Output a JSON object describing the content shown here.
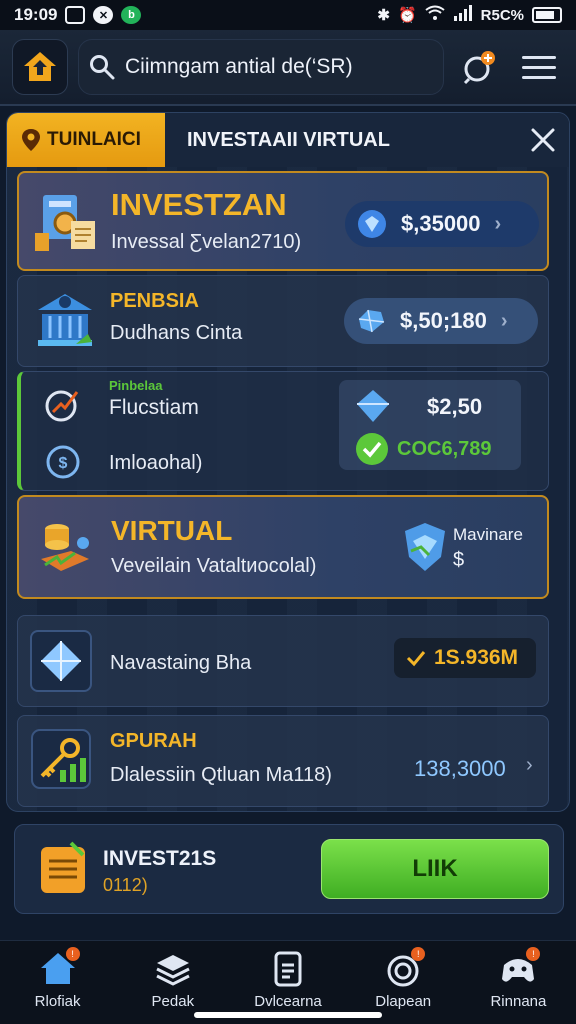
{
  "status_bar": {
    "time": "19:09",
    "battery_text": "R5C%",
    "icons": [
      "image-icon",
      "x-icon",
      "brand-icon",
      "bluetooth-icon",
      "alarm-icon",
      "wifi-icon",
      "signal-icon",
      "battery-icon"
    ]
  },
  "top_bar": {
    "search_value": "Ciimngam antial de(‘SR)",
    "icons": [
      "home-icon",
      "search-icon",
      "notification-icon",
      "menu-icon"
    ]
  },
  "panel": {
    "tab_active": "TUINLAICI",
    "tab_title": "INVESTAAII VIRTUAL",
    "rows": [
      {
        "title": "INVESTZAN",
        "subtitle": "Invessal Ƹvelan2710)",
        "value": "$,35000",
        "icon": "investment-papers-icon",
        "pill_icon": "gem-icon"
      },
      {
        "title": "PENBSIA",
        "subtitle": "Dudhans Cinta",
        "value": "$,50;180",
        "icon": "bank-icon",
        "pill_icon": "crystal-icon"
      },
      {
        "title": "Flucstiam",
        "subtitle": "Imloaohal)",
        "tag": "Pinbelaa",
        "value": "$2,50",
        "value2": "COC6,789",
        "icon": "chart-icon",
        "icon2": "dollar-coin-icon",
        "pill_icon": "diamond-icon",
        "pill_icon2": "check-shield-icon"
      },
      {
        "title": "VIRTUAL",
        "subtitle": "Veveilain Vataltиocolal)",
        "value": "Mavinare",
        "value2": "$",
        "icon": "coins-icon",
        "pill_icon": "shield-icon"
      },
      {
        "title": "",
        "subtitle": "Navastaing Bha",
        "value": "1S.936M",
        "icon": "diamond-icon",
        "pill_icon": "check-icon"
      },
      {
        "title": "GPURAH",
        "subtitle": "Dlalessiin Qtluan Ma118)",
        "value": "138,3000",
        "icon": "key-growth-icon"
      }
    ]
  },
  "bottom_card": {
    "title": "INVEST21S",
    "subtitle": "0112)",
    "button": "LIIK",
    "icon": "notepad-icon"
  },
  "nav": [
    {
      "label": "Rlofiak",
      "icon": "home-icon"
    },
    {
      "label": "Pedak",
      "icon": "layers-icon"
    },
    {
      "label": "Dvlcearna",
      "icon": "card-icon"
    },
    {
      "label": "Dlapean",
      "icon": "target-icon"
    },
    {
      "label": "Rinnana",
      "icon": "controller-icon"
    }
  ],
  "colors": {
    "background": "#0f1a2b",
    "accent_gold": "#f4b629",
    "accent_green": "#5cc83a",
    "panel": "#16243a",
    "badge": "#e8601f"
  }
}
